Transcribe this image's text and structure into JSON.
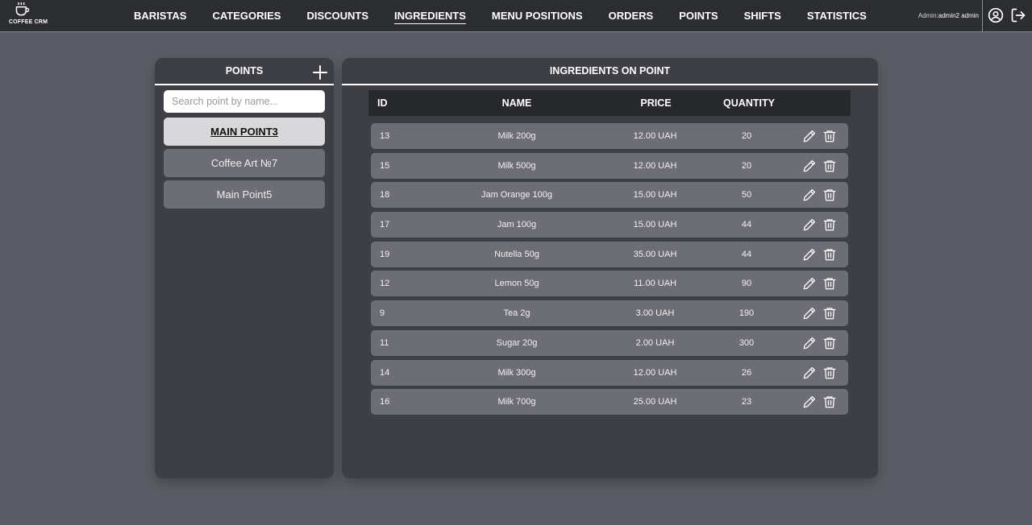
{
  "app": {
    "logo_text": "COFFEE CRM"
  },
  "nav": [
    {
      "label": "BARISTAS",
      "active": false
    },
    {
      "label": "CATEGORIES",
      "active": false
    },
    {
      "label": "DISCOUNTS",
      "active": false
    },
    {
      "label": "INGREDIENTS",
      "active": true
    },
    {
      "label": "MENU POSITIONS",
      "active": false
    },
    {
      "label": "ORDERS",
      "active": false
    },
    {
      "label": "POINTS",
      "active": false
    },
    {
      "label": "SHIFTS",
      "active": false
    },
    {
      "label": "STATISTICS",
      "active": false
    }
  ],
  "user": {
    "role_label": "Admin:",
    "name": "admin2 admin"
  },
  "points_panel": {
    "title": "POINTS",
    "search_placeholder": "Search point by name...",
    "items": [
      {
        "label": "MAIN POINT3",
        "selected": true
      },
      {
        "label": "Coffee Art №7",
        "selected": false
      },
      {
        "label": "Main Point5",
        "selected": false
      }
    ]
  },
  "ingredients_panel": {
    "title": "INGREDIENTS ON POINT",
    "columns": {
      "id": "ID",
      "name": "NAME",
      "price": "PRICE",
      "quantity": "QUANTITY"
    },
    "rows": [
      {
        "id": "13",
        "name": "Milk 200g",
        "price": "12.00 UAH",
        "quantity": "20"
      },
      {
        "id": "15",
        "name": "Milk 500g",
        "price": "12.00 UAH",
        "quantity": "20"
      },
      {
        "id": "18",
        "name": "Jam Orange 100g",
        "price": "15.00 UAH",
        "quantity": "50"
      },
      {
        "id": "17",
        "name": "Jam 100g",
        "price": "15.00 UAH",
        "quantity": "44"
      },
      {
        "id": "19",
        "name": "Nutella 50g",
        "price": "35.00 UAH",
        "quantity": "44"
      },
      {
        "id": "12",
        "name": "Lemon 50g",
        "price": "11.00 UAH",
        "quantity": "90"
      },
      {
        "id": "9",
        "name": "Tea 2g",
        "price": "3.00 UAH",
        "quantity": "190"
      },
      {
        "id": "11",
        "name": "Sugar 20g",
        "price": "2.00 UAH",
        "quantity": "300"
      },
      {
        "id": "14",
        "name": "Milk 300g",
        "price": "12.00 UAH",
        "quantity": "26"
      },
      {
        "id": "16",
        "name": "Milk 700g",
        "price": "25.00 UAH",
        "quantity": "23"
      }
    ]
  },
  "icons": {
    "logo": "coffee-cup-icon",
    "profile": "user-circle-icon",
    "logout": "logout-icon",
    "add": "plus-icon",
    "edit": "pencil-icon",
    "delete": "trash-icon"
  },
  "colors": {
    "background": "#5b5d66",
    "topbar": "#2c2d31",
    "panel": "#3e3f44",
    "row": "#6c6d75",
    "table_header": "#27282c",
    "selected_point": "#d8d8da"
  }
}
